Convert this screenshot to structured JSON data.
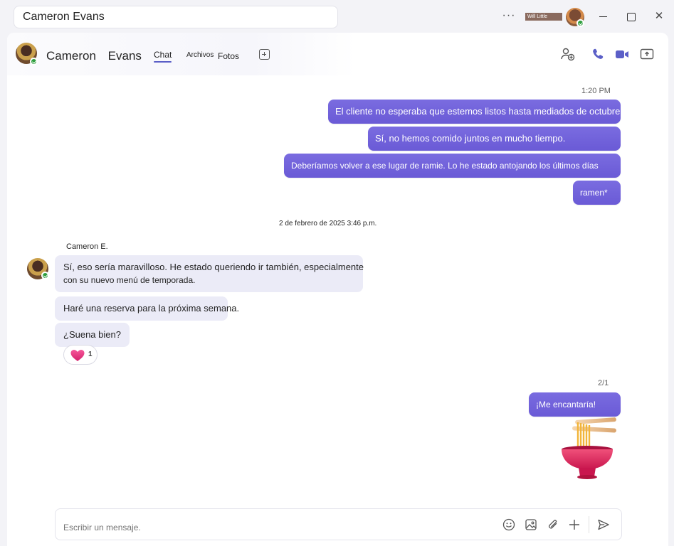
{
  "titlebar": {
    "search_text": "Cameron Evans",
    "user_chip": "Will Little",
    "more_label": "···",
    "close_label": "✕"
  },
  "header": {
    "first_name": "Cameron",
    "last_name": "Evans",
    "tabs": [
      {
        "label": "Chat"
      },
      {
        "label": "Archivos"
      },
      {
        "label": "Fotos"
      }
    ]
  },
  "messages": {
    "out_time_1": "1:20 PM",
    "outgoing_group_1": [
      "El cliente no esperaba que estemos listos hasta mediados de octubre",
      "Sí, no hemos comido juntos en mucho tiempo.",
      "Deberíamos volver a ese lugar de ramie. Lo he estado antojando los últimos días",
      "ramen*"
    ],
    "divider_time": "2 de febrero de 2025 3:46 p.m.",
    "sender_name": "Cameron E.",
    "incoming": {
      "line1a": "Sí, eso sería maravilloso. He estado queriendo ir también, especialmente",
      "line1b": "con su nuevo menú de temporada.",
      "line2": "Haré una reserva para la próxima semana.",
      "line3": "¿Suena bien?"
    },
    "reaction": {
      "icon": "heart-icon",
      "count": "1"
    },
    "out_time_2": "2/1",
    "outgoing_2": "¡Me encantaría!",
    "sticker": "ramen-bowl-icon"
  },
  "composer": {
    "placeholder": "Escribir un mensaje."
  },
  "colors": {
    "accent": "#5b5fc7",
    "bubble_out": "#6f61dc",
    "bubble_in": "#ebebf7",
    "presence": "#2e9e3e"
  }
}
